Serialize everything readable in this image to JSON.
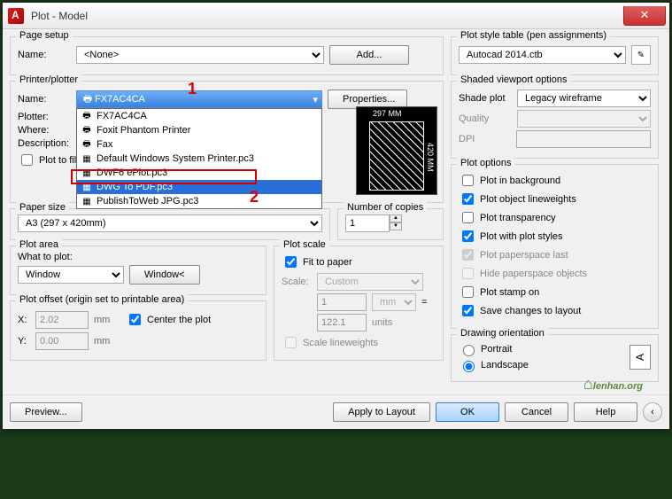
{
  "window": {
    "title": "Plot - Model"
  },
  "pageSetup": {
    "title": "Page setup",
    "nameLabel": "Name:",
    "nameValue": "<None>",
    "addBtn": "Add..."
  },
  "printer": {
    "title": "Printer/plotter",
    "nameLabel": "Name:",
    "plotterLabel": "Plotter:",
    "whereLabel": "Where:",
    "descLabel": "Description:",
    "selected": "FX7AC4CA",
    "propsBtn": "Properties...",
    "plotToFile": "Plot to file",
    "options": [
      "FX7AC4CA",
      "Foxit Phantom Printer",
      "Fax",
      "Default Windows System Printer.pc3",
      "DWF6 ePlot.pc3",
      "DWG To PDF.pc3",
      "PublishToWeb JPG.pc3"
    ],
    "preview": {
      "w": "297 MM",
      "h": "420 MM"
    }
  },
  "paper": {
    "title": "Paper size",
    "value": "A3 (297 x 420mm)"
  },
  "copies": {
    "title": "Number of copies",
    "value": "1"
  },
  "plotArea": {
    "title": "Plot area",
    "whatLabel": "What to plot:",
    "whatValue": "Window",
    "windowBtn": "Window<"
  },
  "plotScale": {
    "title": "Plot scale",
    "fit": "Fit to paper",
    "scaleLabel": "Scale:",
    "scaleValue": "Custom",
    "num": "1",
    "unitSel": "mm",
    "eq": "=",
    "den": "122.1",
    "unitsLbl": "units",
    "scaleLw": "Scale lineweights"
  },
  "plotOffset": {
    "title": "Plot offset (origin set to printable area)",
    "xLabel": "X:",
    "xVal": "2.02",
    "xUnit": "mm",
    "yLabel": "Y:",
    "yVal": "0.00",
    "yUnit": "mm",
    "center": "Center the plot"
  },
  "styleTable": {
    "title": "Plot style table (pen assignments)",
    "value": "Autocad 2014.ctb"
  },
  "shaded": {
    "title": "Shaded viewport options",
    "shadeLabel": "Shade plot",
    "shadeValue": "Legacy wireframe",
    "qualityLabel": "Quality",
    "dpiLabel": "DPI"
  },
  "plotOptions": {
    "title": "Plot options",
    "bg": "Plot in background",
    "lw": "Plot object lineweights",
    "trans": "Plot transparency",
    "styles": "Plot with plot styles",
    "pspace": "Plot paperspace last",
    "hide": "Hide paperspace objects",
    "stamp": "Plot stamp on",
    "save": "Save changes to layout"
  },
  "orientation": {
    "title": "Drawing orientation",
    "portrait": "Portrait",
    "landscape": "Landscape"
  },
  "footer": {
    "preview": "Preview...",
    "apply": "Apply to Layout",
    "ok": "OK",
    "cancel": "Cancel",
    "help": "Help"
  },
  "annotations": {
    "one": "1",
    "two": "2"
  },
  "watermark": "lenhan.org"
}
